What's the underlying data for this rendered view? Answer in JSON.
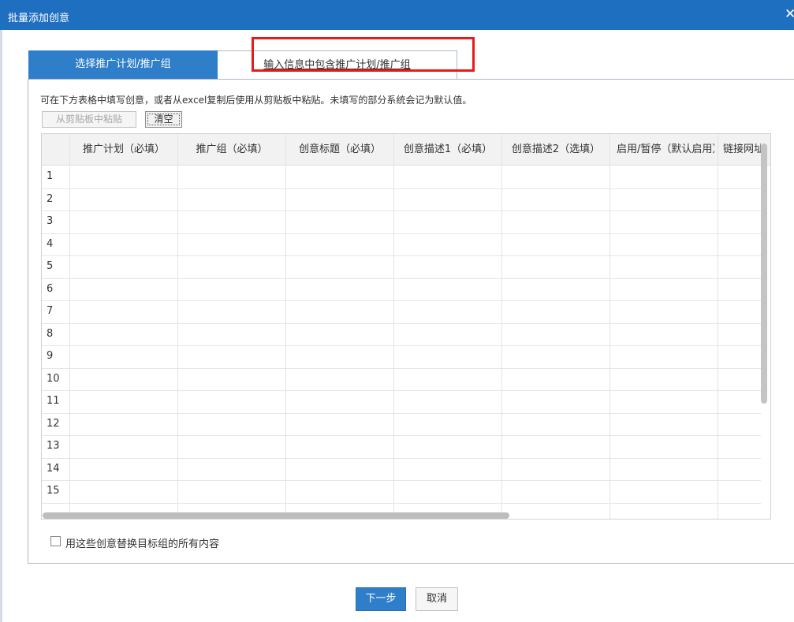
{
  "window": {
    "title": "批量添加创意",
    "close_glyph": "✕"
  },
  "tabs": [
    {
      "label": "选择推广计划/推广组",
      "active": true
    },
    {
      "label": "输入信息中包含推广计划/推广组",
      "active": false
    }
  ],
  "hint_text": "可在下方表格中填写创意，或者从excel复制后使用从剪贴板中粘贴。未填写的部分系统会记为默认值。",
  "toolbar": {
    "paste_label": "从剪贴板中粘贴",
    "clear_label": "清空"
  },
  "table": {
    "columns": [
      "推广计划（必填）",
      "推广组（必填）",
      "创意标题（必填）",
      "创意描述1（必填）",
      "创意描述2（选填）",
      "启用/暂停（默认启用）",
      "链接网址"
    ],
    "rows": [
      "1",
      "2",
      "3",
      "4",
      "5",
      "6",
      "7",
      "8",
      "9",
      "10",
      "11",
      "12",
      "13",
      "14",
      "15"
    ]
  },
  "replace_option": {
    "label": "用这些创意替换目标组的所有内容",
    "checked": false
  },
  "footer": {
    "next_label": "下一步",
    "cancel_label": "取消"
  },
  "colors": {
    "title_bar": "#1f6fc0",
    "active_tab": "#2e7ec9",
    "highlight_box": "#e81b1b",
    "primary_button": "#2e7ec9"
  }
}
